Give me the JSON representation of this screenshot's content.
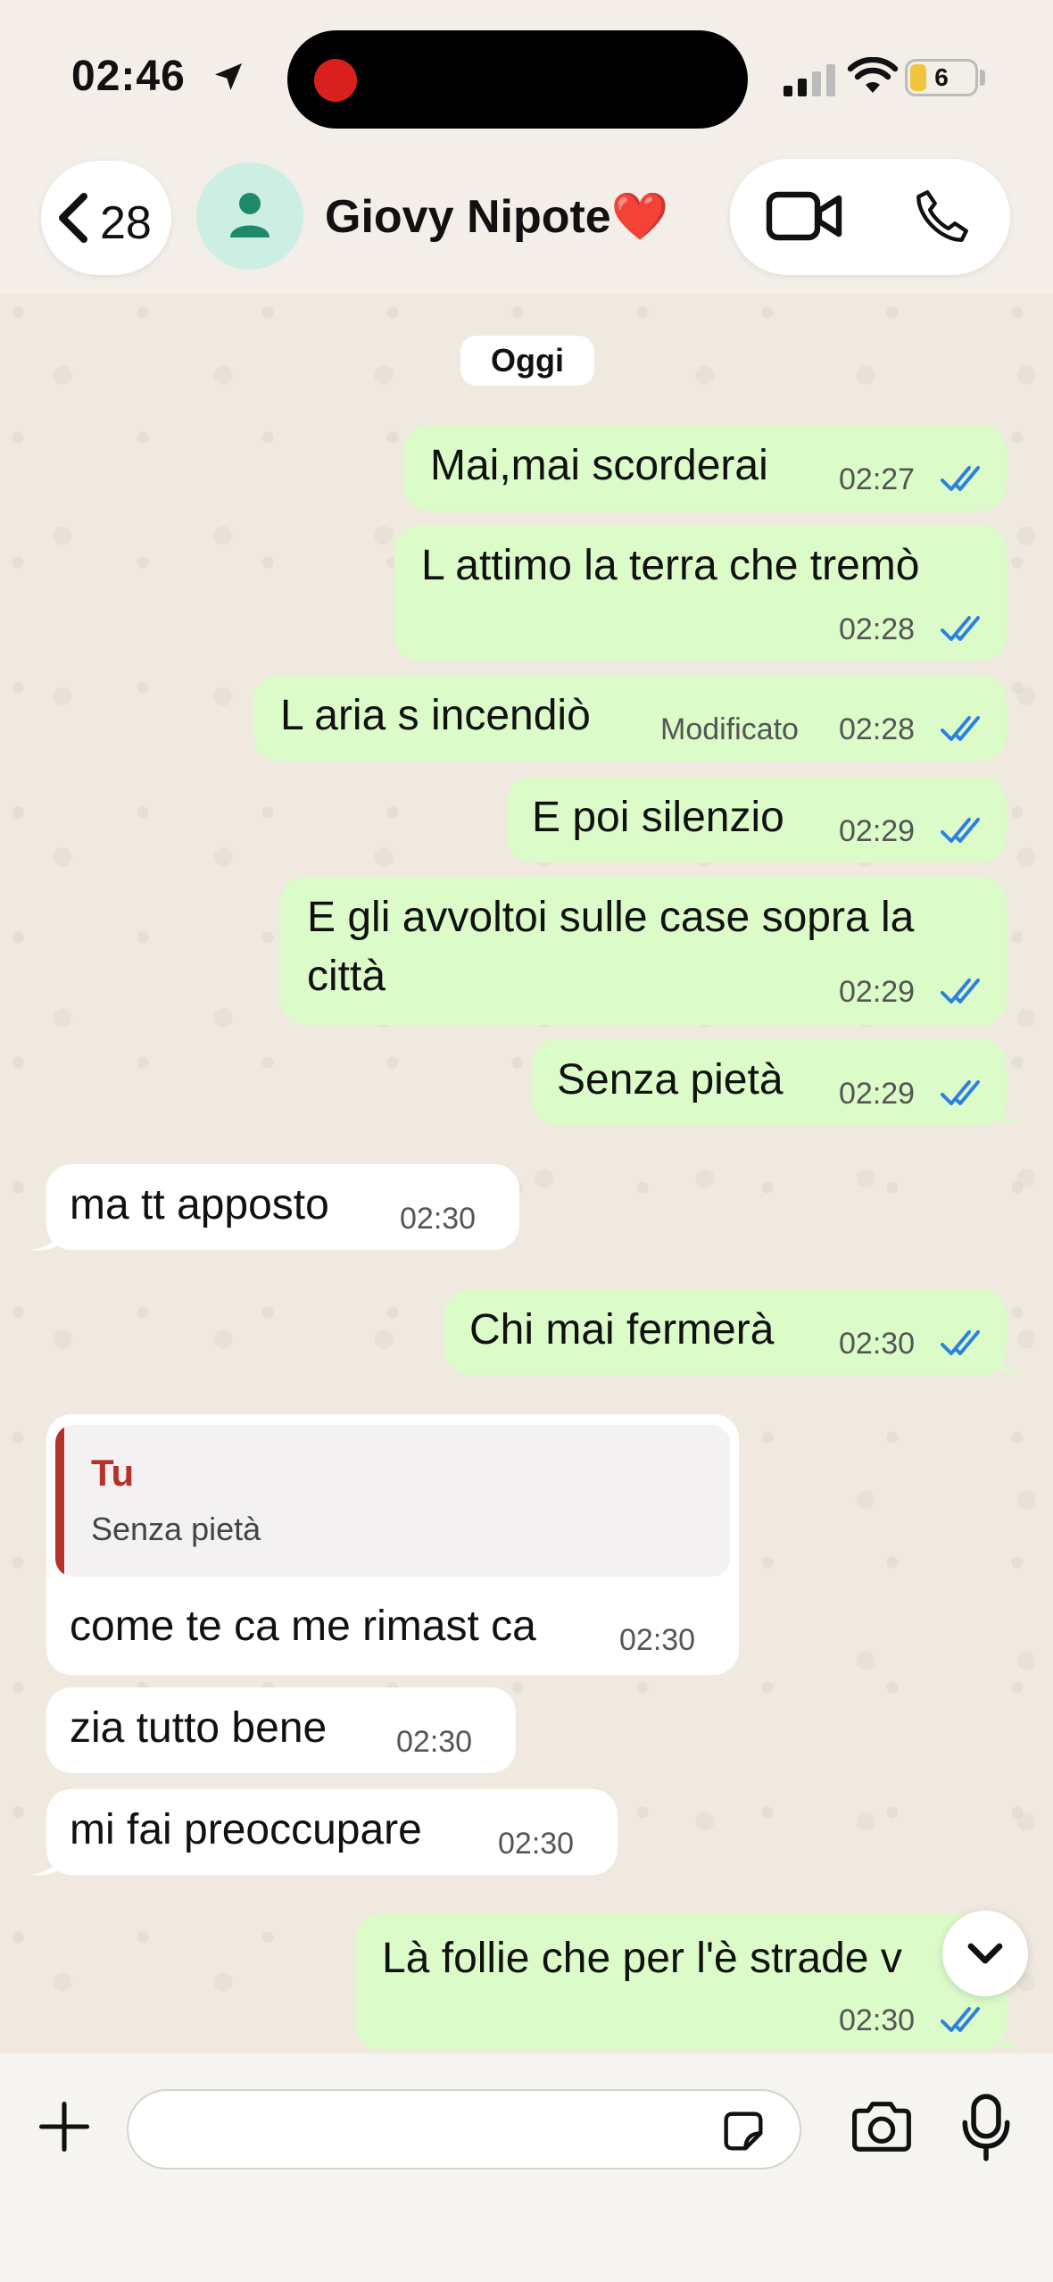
{
  "status_bar": {
    "time": "02:46",
    "battery": "6"
  },
  "header": {
    "back_count": "28",
    "contact_name": "Giovy Nipote❤️"
  },
  "date_chip": "Oggi",
  "messages": [
    {
      "dir": "out",
      "text": "Mai,mai scorderai",
      "time": "02:27"
    },
    {
      "dir": "out",
      "text": "L attimo la terra che tremò",
      "time": "02:28"
    },
    {
      "dir": "out",
      "text": "L aria s incendiò",
      "edited": "Modificato",
      "time": "02:28"
    },
    {
      "dir": "out",
      "text": "E poi silenzio",
      "time": "02:29"
    },
    {
      "dir": "out",
      "text_line1": "E gli avvoltoi sulle case sopra la",
      "text_line2": "città",
      "time": "02:29"
    },
    {
      "dir": "out",
      "text": "Senza pietà",
      "time": "02:29"
    },
    {
      "dir": "in",
      "text": "ma tt apposto",
      "time": "02:30"
    },
    {
      "dir": "out",
      "text": "Chi mai fermerà",
      "time": "02:30"
    },
    {
      "dir": "in",
      "quote_author": "Tu",
      "quote_text": "Senza pietà",
      "text": "come te ca me rimast ca",
      "time": "02:30"
    },
    {
      "dir": "in",
      "text": "zia tutto bene",
      "time": "02:30"
    },
    {
      "dir": "in",
      "text": "mi fai preoccupare",
      "time": "02:30"
    },
    {
      "dir": "out",
      "text": "Là follie che per l'è strade v",
      "time": "02:30"
    }
  ],
  "colors": {
    "outgoing": "#dbfbc9",
    "incoming": "#ffffff",
    "tick_blue": "#2f7fe0",
    "quote_red": "#b3322a"
  },
  "icons": [
    "location-arrow-icon",
    "signal-icon",
    "wifi-icon",
    "battery-icon",
    "chevron-left-icon",
    "person-icon",
    "video-call-icon",
    "phone-icon",
    "double-check-icon",
    "chevron-down-icon",
    "plus-icon",
    "sticker-icon",
    "camera-icon",
    "microphone-icon"
  ]
}
